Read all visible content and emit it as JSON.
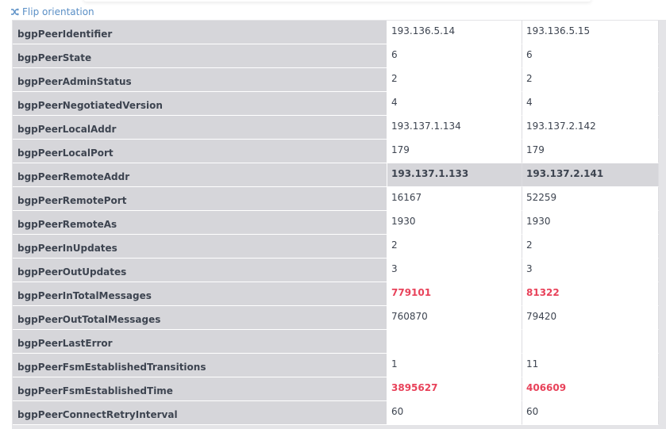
{
  "toolbar": {
    "flip_label": "Flip orientation"
  },
  "colors": {
    "link": "#5a8fc6",
    "highlight_red": "#e8425a",
    "label_bg": "#d6d6da"
  },
  "rows": [
    {
      "label": "bgpPeerIdentifier",
      "v1": "193.136.5.14",
      "v2": "193.136.5.15"
    },
    {
      "label": "bgpPeerState",
      "v1": "6",
      "v2": "6"
    },
    {
      "label": "bgpPeerAdminStatus",
      "v1": "2",
      "v2": "2"
    },
    {
      "label": "bgpPeerNegotiatedVersion",
      "v1": "4",
      "v2": "4"
    },
    {
      "label": "bgpPeerLocalAddr",
      "v1": "193.137.1.134",
      "v2": "193.137.2.142"
    },
    {
      "label": "bgpPeerLocalPort",
      "v1": "179",
      "v2": "179"
    },
    {
      "label": "bgpPeerRemoteAddr",
      "v1": "193.137.1.133",
      "v2": "193.137.2.141"
    },
    {
      "label": "bgpPeerRemotePort",
      "v1": "16167",
      "v2": "52259"
    },
    {
      "label": "bgpPeerRemoteAs",
      "v1": "1930",
      "v2": "1930"
    },
    {
      "label": "bgpPeerInUpdates",
      "v1": "2",
      "v2": "2"
    },
    {
      "label": "bgpPeerOutUpdates",
      "v1": "3",
      "v2": "3"
    },
    {
      "label": "bgpPeerInTotalMessages",
      "v1": "779101",
      "v2": "81322"
    },
    {
      "label": "bgpPeerOutTotalMessages",
      "v1": "760870",
      "v2": "79420"
    },
    {
      "label": "bgpPeerLastError",
      "v1": "",
      "v2": ""
    },
    {
      "label": "bgpPeerFsmEstablishedTransitions",
      "v1": "1",
      "v2": "11"
    },
    {
      "label": "bgpPeerFsmEstablishedTime",
      "v1": "3895627",
      "v2": "406609"
    },
    {
      "label": "bgpPeerConnectRetryInterval",
      "v1": "60",
      "v2": "60"
    }
  ]
}
